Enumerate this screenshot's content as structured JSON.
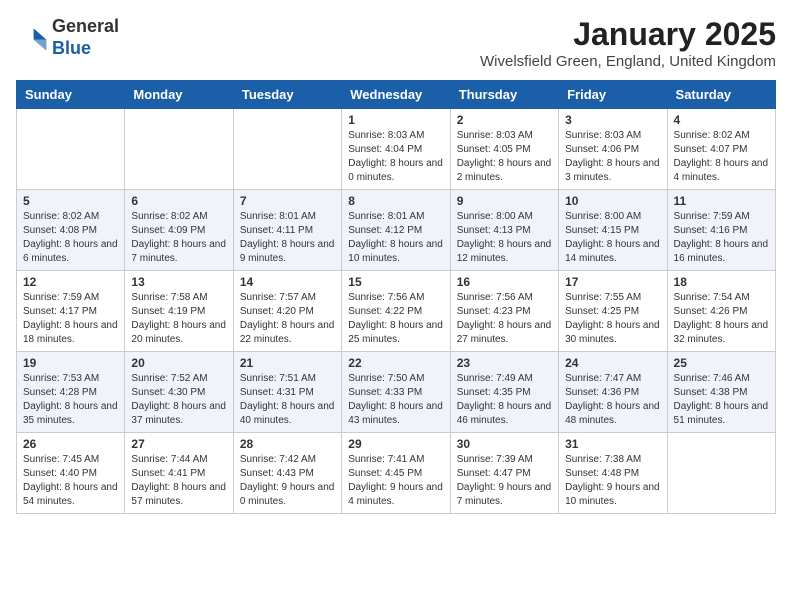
{
  "logo": {
    "general": "General",
    "blue": "Blue"
  },
  "header": {
    "month": "January 2025",
    "location": "Wivelsfield Green, England, United Kingdom"
  },
  "weekdays": [
    "Sunday",
    "Monday",
    "Tuesday",
    "Wednesday",
    "Thursday",
    "Friday",
    "Saturday"
  ],
  "weeks": [
    [
      null,
      null,
      null,
      {
        "day": "1",
        "sunrise": "8:03 AM",
        "sunset": "4:04 PM",
        "daylight": "8 hours and 0 minutes."
      },
      {
        "day": "2",
        "sunrise": "8:03 AM",
        "sunset": "4:05 PM",
        "daylight": "8 hours and 2 minutes."
      },
      {
        "day": "3",
        "sunrise": "8:03 AM",
        "sunset": "4:06 PM",
        "daylight": "8 hours and 3 minutes."
      },
      {
        "day": "4",
        "sunrise": "8:02 AM",
        "sunset": "4:07 PM",
        "daylight": "8 hours and 4 minutes."
      }
    ],
    [
      {
        "day": "5",
        "sunrise": "8:02 AM",
        "sunset": "4:08 PM",
        "daylight": "8 hours and 6 minutes."
      },
      {
        "day": "6",
        "sunrise": "8:02 AM",
        "sunset": "4:09 PM",
        "daylight": "8 hours and 7 minutes."
      },
      {
        "day": "7",
        "sunrise": "8:01 AM",
        "sunset": "4:11 PM",
        "daylight": "8 hours and 9 minutes."
      },
      {
        "day": "8",
        "sunrise": "8:01 AM",
        "sunset": "4:12 PM",
        "daylight": "8 hours and 10 minutes."
      },
      {
        "day": "9",
        "sunrise": "8:00 AM",
        "sunset": "4:13 PM",
        "daylight": "8 hours and 12 minutes."
      },
      {
        "day": "10",
        "sunrise": "8:00 AM",
        "sunset": "4:15 PM",
        "daylight": "8 hours and 14 minutes."
      },
      {
        "day": "11",
        "sunrise": "7:59 AM",
        "sunset": "4:16 PM",
        "daylight": "8 hours and 16 minutes."
      }
    ],
    [
      {
        "day": "12",
        "sunrise": "7:59 AM",
        "sunset": "4:17 PM",
        "daylight": "8 hours and 18 minutes."
      },
      {
        "day": "13",
        "sunrise": "7:58 AM",
        "sunset": "4:19 PM",
        "daylight": "8 hours and 20 minutes."
      },
      {
        "day": "14",
        "sunrise": "7:57 AM",
        "sunset": "4:20 PM",
        "daylight": "8 hours and 22 minutes."
      },
      {
        "day": "15",
        "sunrise": "7:56 AM",
        "sunset": "4:22 PM",
        "daylight": "8 hours and 25 minutes."
      },
      {
        "day": "16",
        "sunrise": "7:56 AM",
        "sunset": "4:23 PM",
        "daylight": "8 hours and 27 minutes."
      },
      {
        "day": "17",
        "sunrise": "7:55 AM",
        "sunset": "4:25 PM",
        "daylight": "8 hours and 30 minutes."
      },
      {
        "day": "18",
        "sunrise": "7:54 AM",
        "sunset": "4:26 PM",
        "daylight": "8 hours and 32 minutes."
      }
    ],
    [
      {
        "day": "19",
        "sunrise": "7:53 AM",
        "sunset": "4:28 PM",
        "daylight": "8 hours and 35 minutes."
      },
      {
        "day": "20",
        "sunrise": "7:52 AM",
        "sunset": "4:30 PM",
        "daylight": "8 hours and 37 minutes."
      },
      {
        "day": "21",
        "sunrise": "7:51 AM",
        "sunset": "4:31 PM",
        "daylight": "8 hours and 40 minutes."
      },
      {
        "day": "22",
        "sunrise": "7:50 AM",
        "sunset": "4:33 PM",
        "daylight": "8 hours and 43 minutes."
      },
      {
        "day": "23",
        "sunrise": "7:49 AM",
        "sunset": "4:35 PM",
        "daylight": "8 hours and 46 minutes."
      },
      {
        "day": "24",
        "sunrise": "7:47 AM",
        "sunset": "4:36 PM",
        "daylight": "8 hours and 48 minutes."
      },
      {
        "day": "25",
        "sunrise": "7:46 AM",
        "sunset": "4:38 PM",
        "daylight": "8 hours and 51 minutes."
      }
    ],
    [
      {
        "day": "26",
        "sunrise": "7:45 AM",
        "sunset": "4:40 PM",
        "daylight": "8 hours and 54 minutes."
      },
      {
        "day": "27",
        "sunrise": "7:44 AM",
        "sunset": "4:41 PM",
        "daylight": "8 hours and 57 minutes."
      },
      {
        "day": "28",
        "sunrise": "7:42 AM",
        "sunset": "4:43 PM",
        "daylight": "9 hours and 0 minutes."
      },
      {
        "day": "29",
        "sunrise": "7:41 AM",
        "sunset": "4:45 PM",
        "daylight": "9 hours and 4 minutes."
      },
      {
        "day": "30",
        "sunrise": "7:39 AM",
        "sunset": "4:47 PM",
        "daylight": "9 hours and 7 minutes."
      },
      {
        "day": "31",
        "sunrise": "7:38 AM",
        "sunset": "4:48 PM",
        "daylight": "9 hours and 10 minutes."
      },
      null
    ]
  ]
}
